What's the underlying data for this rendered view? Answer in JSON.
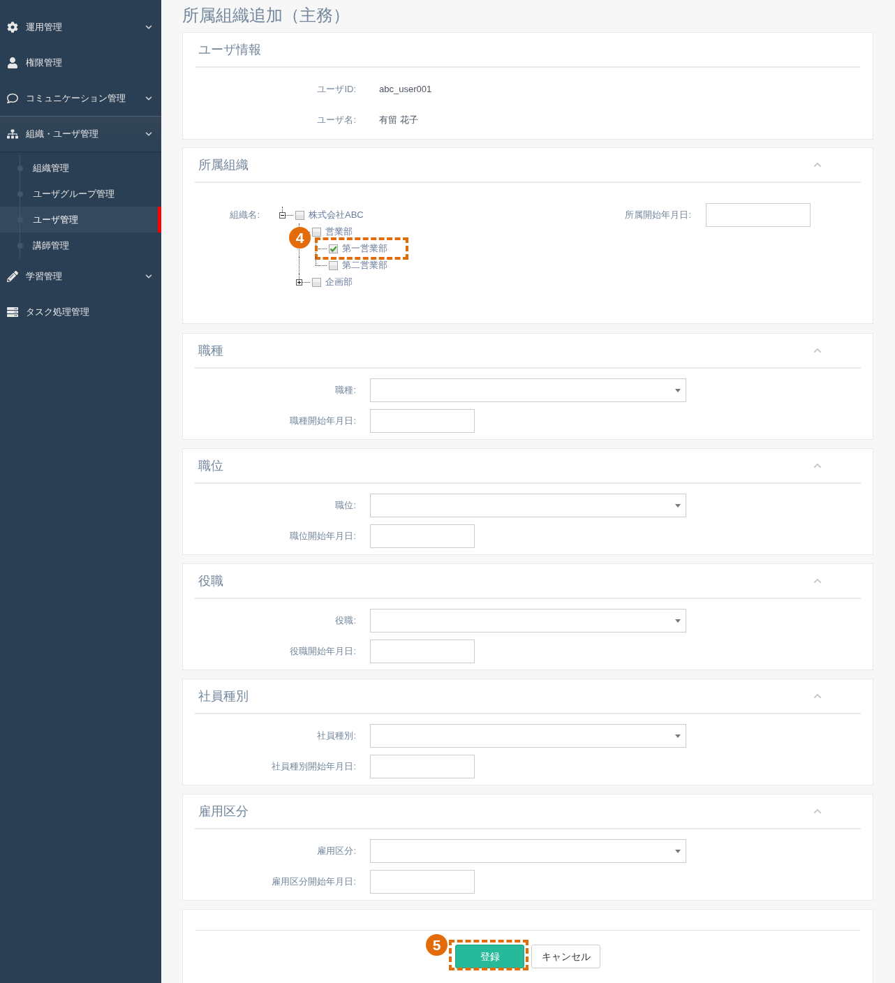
{
  "sidebar": {
    "items": [
      {
        "label": "運用管理",
        "expanded": false
      },
      {
        "label": "権限管理"
      },
      {
        "label": "コミュニケーション管理",
        "expanded": false
      },
      {
        "label": "組織・ユーザ管理",
        "expanded": true,
        "children": [
          {
            "label": "組織管理",
            "selected": false
          },
          {
            "label": "ユーザグループ管理",
            "selected": false
          },
          {
            "label": "ユーザ管理",
            "selected": true
          },
          {
            "label": "講師管理",
            "selected": false
          }
        ]
      },
      {
        "label": "学習管理",
        "expanded": false
      },
      {
        "label": "タスク処理管理"
      }
    ]
  },
  "page_title": "所属組織追加（主務）",
  "panels": [
    {
      "kind": "info",
      "title": "ユーザ情報",
      "fields": [
        {
          "label": "ユーザID:",
          "value": "abc_user001"
        },
        {
          "label": "ユーザ名:",
          "value": "有留 花子"
        }
      ]
    },
    {
      "kind": "tree",
      "title": "所属組織",
      "expanded": true,
      "tree_label": "組織名:",
      "tree": [
        {
          "label": "株式会社ABC",
          "checked": false,
          "expanded": true,
          "children": [
            {
              "label": "営業部",
              "checked": false,
              "children": [
                {
                  "label": "第一営業部",
                  "checked": true,
                  "callout": "4"
                },
                {
                  "label": "第二営業部",
                  "checked": false
                }
              ]
            },
            {
              "label": "企画部",
              "checked": false,
              "expanded": false
            }
          ]
        }
      ],
      "date_label": "所属開始年月日:"
    },
    {
      "kind": "select",
      "title": "職種",
      "expanded": true,
      "select_label": "職種:",
      "date_label": "職種開始年月日:"
    },
    {
      "kind": "select",
      "title": "職位",
      "expanded": true,
      "select_label": "職位:",
      "date_label": "職位開始年月日:"
    },
    {
      "kind": "select",
      "title": "役職",
      "expanded": true,
      "select_label": "役職:",
      "date_label": "役職開始年月日:"
    },
    {
      "kind": "select",
      "title": "社員種別",
      "expanded": true,
      "select_label": "社員種別:",
      "date_label": "社員種別開始年月日:"
    },
    {
      "kind": "select",
      "title": "雇用区分",
      "expanded": true,
      "select_label": "雇用区分:",
      "date_label": "雇用区分開始年月日:"
    },
    {
      "kind": "actions",
      "buttons": [
        {
          "label": "登録",
          "kind": "primary",
          "callout": "5"
        },
        {
          "label": "キャンセル",
          "kind": "default"
        }
      ]
    }
  ]
}
